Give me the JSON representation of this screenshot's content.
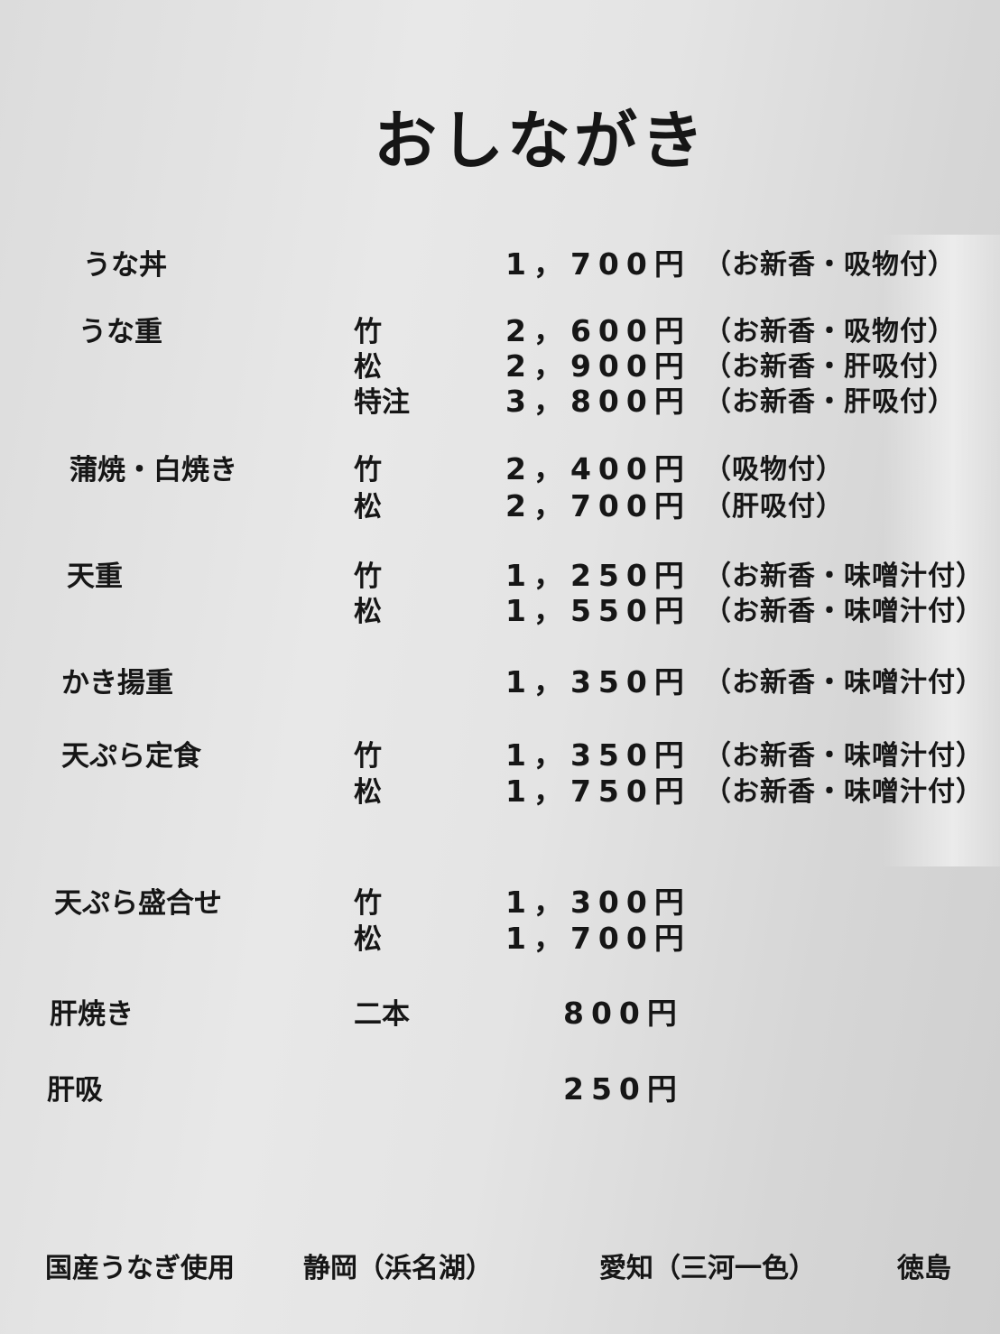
{
  "title": "おしながき",
  "items": [
    {
      "name": "うな丼",
      "lines": [
        {
          "grade": "",
          "price": "1，700円",
          "note": "（お新香・吸物付）"
        }
      ]
    },
    {
      "name": "うな重",
      "lines": [
        {
          "grade": "竹",
          "price": "2，600円",
          "note": "（お新香・吸物付）"
        },
        {
          "grade": "松",
          "price": "2，900円",
          "note": "（お新香・肝吸付）"
        },
        {
          "grade": "特注",
          "price": "3，800円",
          "note": "（お新香・肝吸付）"
        }
      ]
    },
    {
      "name": "蒲焼・白焼き",
      "lines": [
        {
          "grade": "竹",
          "price": "2，400円",
          "note": "（吸物付）"
        },
        {
          "grade": "松",
          "price": "2，700円",
          "note": "（肝吸付）"
        }
      ]
    },
    {
      "name": "天重",
      "lines": [
        {
          "grade": "竹",
          "price": "1，250円",
          "note": "（お新香・味噌汁付）"
        },
        {
          "grade": "松",
          "price": "1，550円",
          "note": "（お新香・味噌汁付）"
        }
      ]
    },
    {
      "name": "かき揚重",
      "lines": [
        {
          "grade": "",
          "price": "1，350円",
          "note": "（お新香・味噌汁付）"
        }
      ]
    },
    {
      "name": "天ぷら定食",
      "lines": [
        {
          "grade": "竹",
          "price": "1，350円",
          "note": "（お新香・味噌汁付）"
        },
        {
          "grade": "松",
          "price": "1，750円",
          "note": "（お新香・味噌汁付）"
        }
      ]
    },
    {
      "name": "天ぷら盛合せ",
      "lines": [
        {
          "grade": "竹",
          "price": "1，300円",
          "note": ""
        },
        {
          "grade": "松",
          "price": "1，700円",
          "note": ""
        }
      ]
    },
    {
      "name": "肝焼き",
      "lines": [
        {
          "grade": "二本",
          "price": "800円",
          "note": ""
        }
      ]
    },
    {
      "name": "肝吸",
      "lines": [
        {
          "grade": "",
          "price": "250円",
          "note": ""
        }
      ]
    }
  ],
  "footer": {
    "label": "国産うなぎ使用",
    "origin1": "静岡（浜名湖）",
    "origin2": "愛知（三河一色）",
    "origin3": "徳島"
  }
}
